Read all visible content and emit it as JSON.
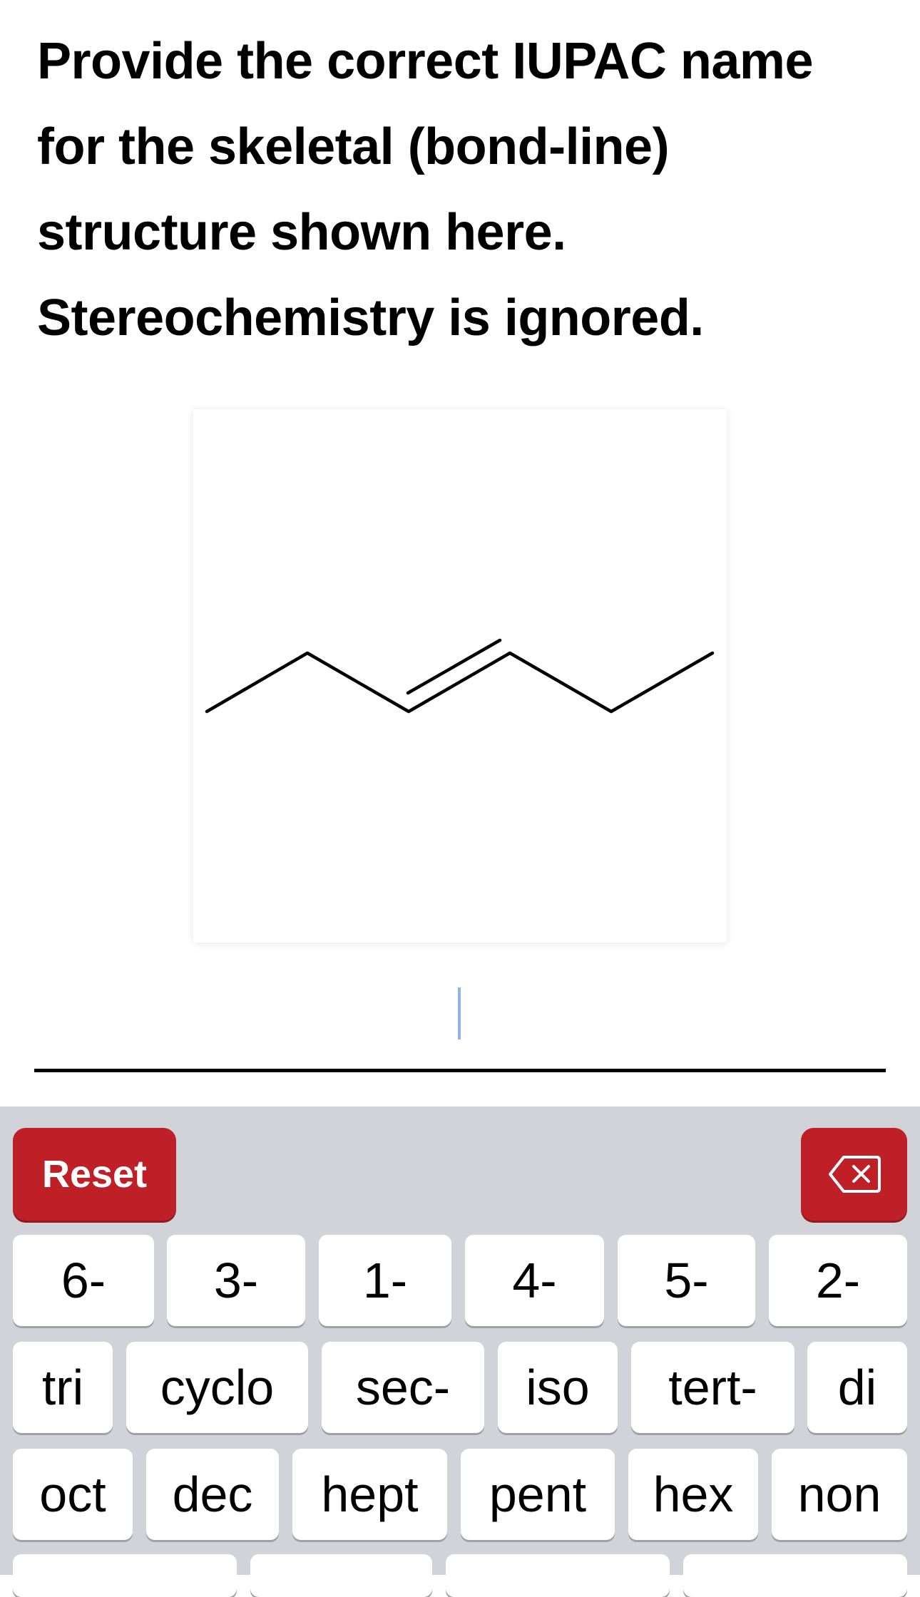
{
  "question": {
    "lines": [
      "Provide the correct IUPAC name",
      "for the skeletal (bond-line)",
      "structure shown here.",
      "Stereochemistry is ignored."
    ]
  },
  "answer": {
    "value": ""
  },
  "keyboard": {
    "reset_label": "Reset",
    "backspace_icon": "backspace-icon",
    "row1": [
      "6-",
      "3-",
      "1-",
      "4-",
      "5-",
      "2-"
    ],
    "row2": [
      "tri",
      "cyclo",
      "sec-",
      "iso",
      "tert-",
      "di"
    ],
    "row3": [
      "oct",
      "dec",
      "hept",
      "pent",
      "hex",
      "non"
    ]
  },
  "colors": {
    "accent_red": "#bf1f27",
    "keyboard_bg": "#d1d3d9",
    "cursor": "#8fb4e6"
  }
}
